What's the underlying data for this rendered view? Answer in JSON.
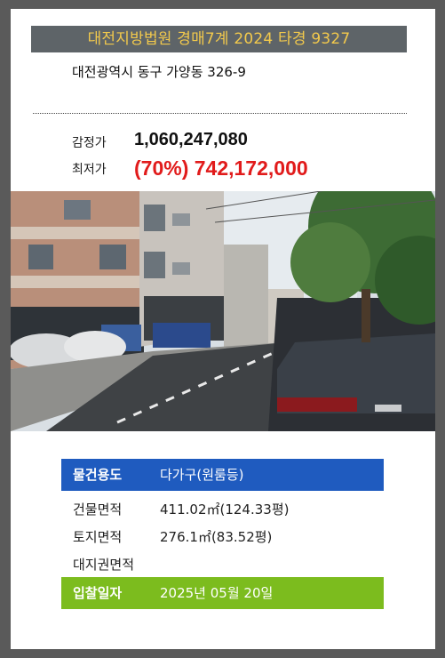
{
  "header": {
    "title": "대전지방법원 경매7계 2024 타경 9327"
  },
  "address": "대전광역시 동구 가양동 326-9",
  "prices": {
    "appraisal_label": "감정가",
    "appraisal_value": "1,060,247,080",
    "minimum_label": "최저가",
    "minimum_value": "(70%) 742,172,000"
  },
  "photo": {
    "type": "street-view"
  },
  "details": {
    "usage_label": "물건용도",
    "usage_value": "다가구(원룸등)",
    "building_area_label": "건물면적",
    "building_area_value": "411.02㎡(124.33평)",
    "land_area_label": "토지면적",
    "land_area_value": "276.1㎡(83.52평)",
    "land_right_label": "대지권면적",
    "land_right_value": "",
    "bid_date_label": "입찰일자",
    "bid_date_value": "2025년 05월 20일"
  },
  "colors": {
    "background": "#5a5a5a",
    "title_bar": "#5e6468",
    "title_text": "#f2c94c",
    "accent_blue": "#1f5bbf",
    "accent_green": "#7cbc1e",
    "price_red": "#e11b1b"
  }
}
